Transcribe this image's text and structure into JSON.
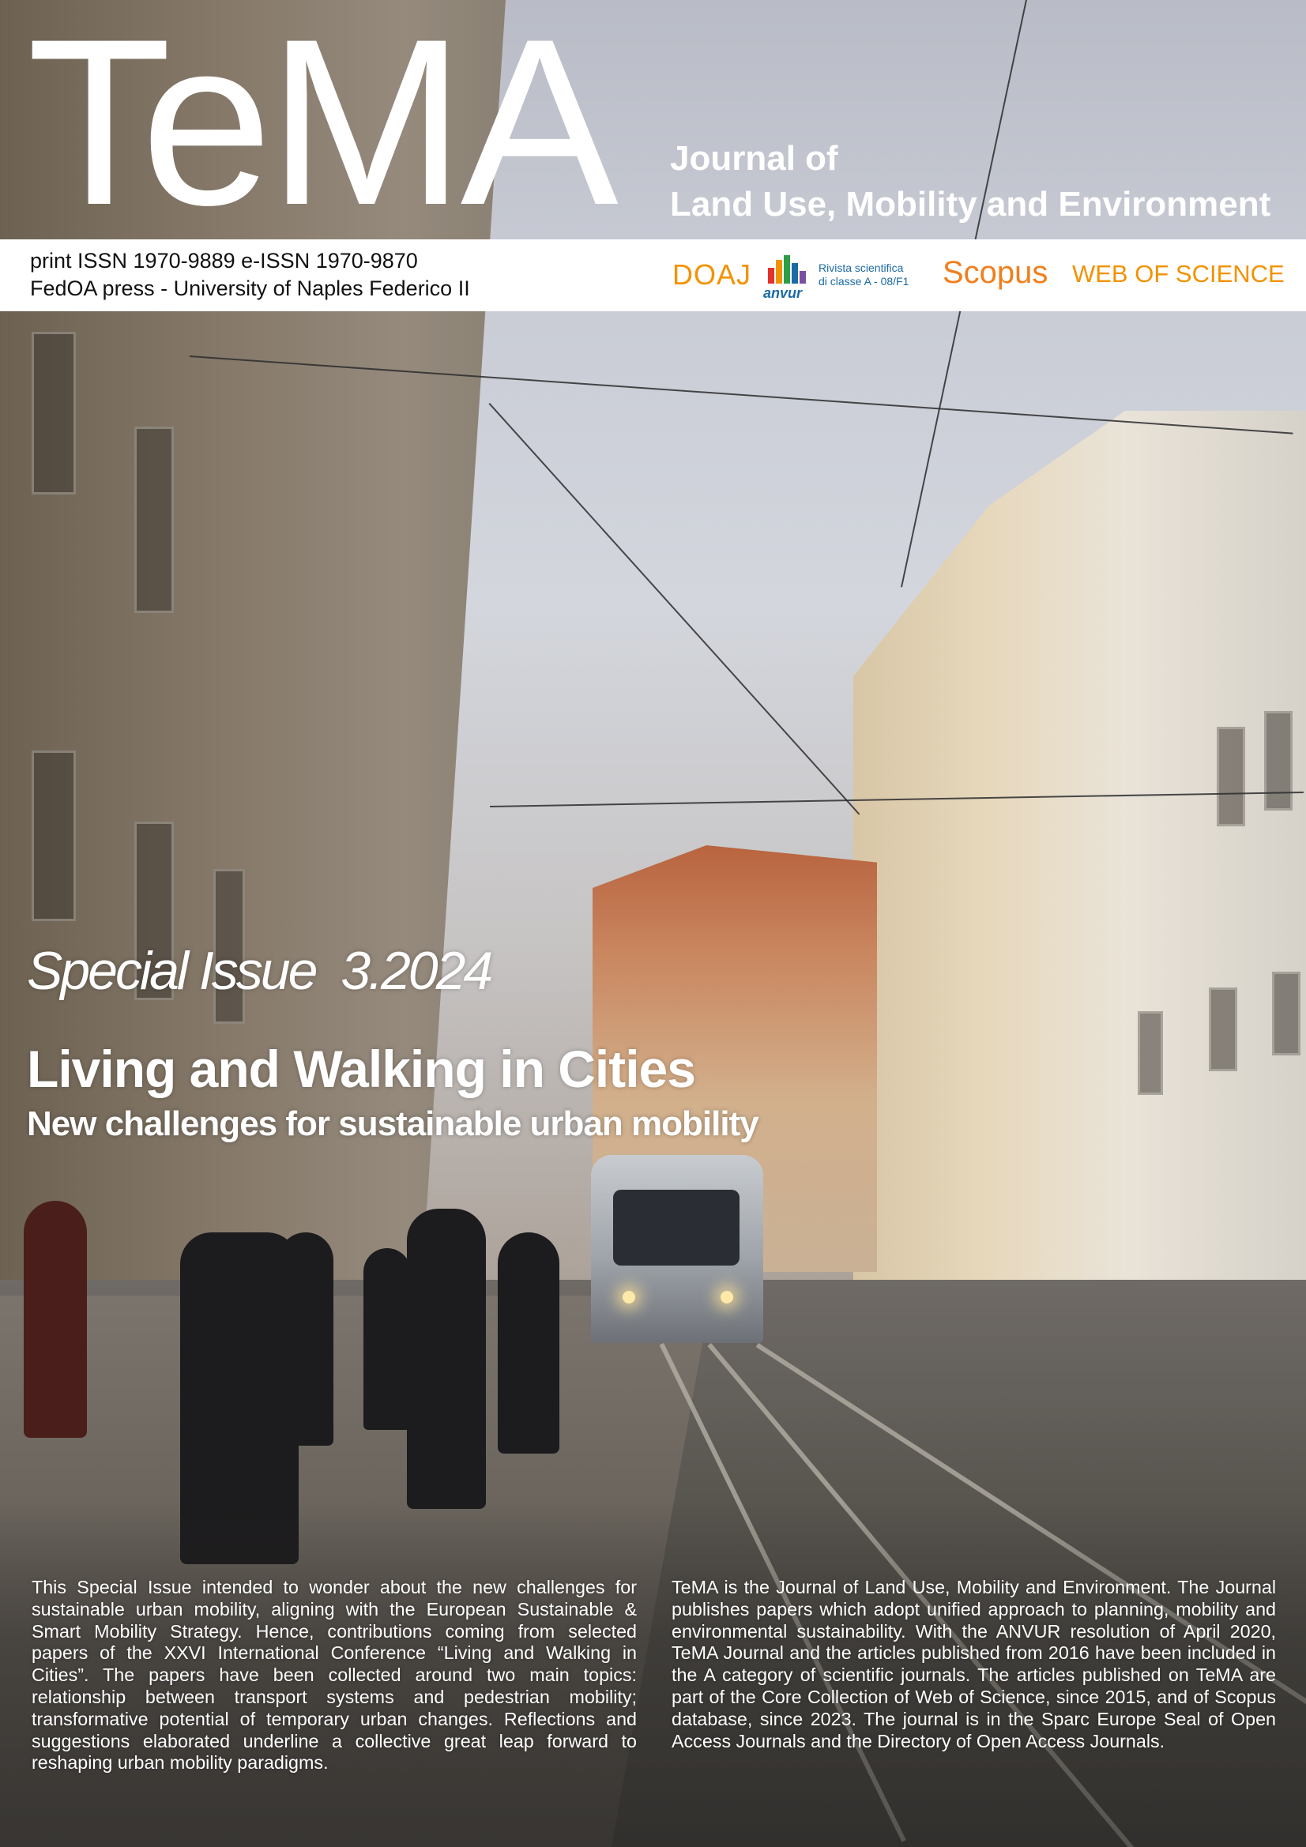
{
  "masthead": {
    "logo": "TeMA",
    "journal_line1": "Journal of",
    "journal_line2": "Land Use, Mobility and Environment"
  },
  "publisher_band": {
    "issn": "print ISSN 1970-9889 e-ISSN 1970-9870",
    "press": "FedOA press - University of Naples Federico II",
    "badges": {
      "doaj": "DOAJ",
      "anvur_name": "anvur",
      "anvur_line1": "Rivista scientifica",
      "anvur_line2": "di classe A - 08/F1",
      "scopus": "Scopus",
      "wos": "WEB OF SCIENCE"
    }
  },
  "issue": {
    "label": "Special Issue  3.2024",
    "title": "Living and Walking in Cities",
    "subtitle": "New challenges for sustainable urban mobility"
  },
  "body": {
    "left_paragraph": "This Special Issue intended to wonder about the new challenges for sustainable urban mobility, aligning with the European Sustainable & Smart Mobility Strategy. Hence, contributions coming from selected papers of the XXVI International Conference “Living and Walking in Cities”. The papers have been collected around two main topics: relationship between transport systems and pedestrian mobility; transformative potential of temporary urban changes. Reflections and suggestions elaborated underline a collective great leap forward to reshaping urban mobility paradigms.",
    "right_paragraph": "TeMA is the Journal of Land Use, Mobility and Environment. The Journal publishes papers which adopt unified approach to planning, mobility and environmental sustainability. With the ANVUR resolution of April 2020, TeMA Journal and the articles published from 2016 have been included in the A category of scientific journals. The articles published on TeMA are part of the Core Collection of Web of Science, since 2015, and of Scopus database, since 2023. The journal is in the Sparc Europe Seal of Open Access Journals and the Directory of Open Access Journals."
  },
  "colors": {
    "badge_orange": "#f39200",
    "anvur_blue": "#1a6aa6",
    "band_white": "#ffffff"
  }
}
